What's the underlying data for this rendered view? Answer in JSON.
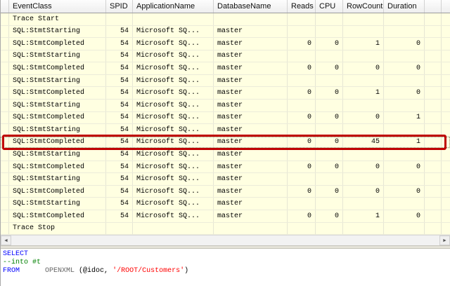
{
  "colors": {
    "row_background": "#ffffe1",
    "highlight_border": "#bf0000",
    "keyword": "#0000ff",
    "comment": "#008000",
    "string": "#ff0000",
    "identifier": "#666666",
    "plain": "#000000"
  },
  "scrollbar": {
    "left_arrow": "◄",
    "right_arrow": "►"
  },
  "grid": {
    "columns": [
      {
        "id": "gutter",
        "label": "",
        "width": 12,
        "align": "left"
      },
      {
        "id": "event",
        "label": "EventClass",
        "width": 138,
        "align": "left"
      },
      {
        "id": "spid",
        "label": "SPID",
        "width": 38,
        "align": "right"
      },
      {
        "id": "app",
        "label": "ApplicationName",
        "width": 115,
        "align": "left"
      },
      {
        "id": "db",
        "label": "DatabaseName",
        "width": 105,
        "align": "left"
      },
      {
        "id": "reads",
        "label": "Reads",
        "width": 40,
        "align": "right"
      },
      {
        "id": "cpu",
        "label": "CPU",
        "width": 39,
        "align": "right"
      },
      {
        "id": "rowcounts",
        "label": "RowCounts",
        "width": 58,
        "align": "right"
      },
      {
        "id": "duration",
        "label": "Duration",
        "width": 58,
        "align": "right"
      },
      {
        "id": "filler",
        "label": "",
        "width": 24,
        "align": "left"
      },
      {
        "id": "filler2",
        "label": "",
        "width": 13,
        "align": "left"
      }
    ],
    "rows": [
      {
        "event": "Trace Start",
        "spid": "",
        "app": "",
        "db": "",
        "reads": "",
        "cpu": "",
        "rowcounts": "",
        "duration": "",
        "highlight": false
      },
      {
        "event": "SQL:StmtStarting",
        "spid": "54",
        "app": "Microsoft SQ...",
        "db": "master",
        "reads": "",
        "cpu": "",
        "rowcounts": "",
        "duration": "",
        "highlight": false
      },
      {
        "event": "SQL:StmtCompleted",
        "spid": "54",
        "app": "Microsoft SQ...",
        "db": "master",
        "reads": "0",
        "cpu": "0",
        "rowcounts": "1",
        "duration": "0",
        "highlight": false
      },
      {
        "event": "SQL:StmtStarting",
        "spid": "54",
        "app": "Microsoft SQ...",
        "db": "master",
        "reads": "",
        "cpu": "",
        "rowcounts": "",
        "duration": "",
        "highlight": false
      },
      {
        "event": "SQL:StmtCompleted",
        "spid": "54",
        "app": "Microsoft SQ...",
        "db": "master",
        "reads": "0",
        "cpu": "0",
        "rowcounts": "0",
        "duration": "0",
        "highlight": false
      },
      {
        "event": "SQL:StmtStarting",
        "spid": "54",
        "app": "Microsoft SQ...",
        "db": "master",
        "reads": "",
        "cpu": "",
        "rowcounts": "",
        "duration": "",
        "highlight": false
      },
      {
        "event": "SQL:StmtCompleted",
        "spid": "54",
        "app": "Microsoft SQ...",
        "db": "master",
        "reads": "0",
        "cpu": "0",
        "rowcounts": "1",
        "duration": "0",
        "highlight": false
      },
      {
        "event": "SQL:StmtStarting",
        "spid": "54",
        "app": "Microsoft SQ...",
        "db": "master",
        "reads": "",
        "cpu": "",
        "rowcounts": "",
        "duration": "",
        "highlight": false
      },
      {
        "event": "SQL:StmtCompleted",
        "spid": "54",
        "app": "Microsoft SQ...",
        "db": "master",
        "reads": "0",
        "cpu": "0",
        "rowcounts": "0",
        "duration": "1",
        "highlight": false
      },
      {
        "event": "SQL:StmtStarting",
        "spid": "54",
        "app": "Microsoft SQ...",
        "db": "master",
        "reads": "",
        "cpu": "",
        "rowcounts": "",
        "duration": "",
        "highlight": false
      },
      {
        "event": "SQL:StmtCompleted",
        "spid": "54",
        "app": "Microsoft SQ...",
        "db": "master",
        "reads": "0",
        "cpu": "0",
        "rowcounts": "45",
        "duration": "1",
        "highlight": true
      },
      {
        "event": "SQL:StmtStarting",
        "spid": "54",
        "app": "Microsoft SQ...",
        "db": "master",
        "reads": "",
        "cpu": "",
        "rowcounts": "",
        "duration": "",
        "highlight": false
      },
      {
        "event": "SQL:StmtCompleted",
        "spid": "54",
        "app": "Microsoft SQ...",
        "db": "master",
        "reads": "0",
        "cpu": "0",
        "rowcounts": "0",
        "duration": "0",
        "highlight": false
      },
      {
        "event": "SQL:StmtStarting",
        "spid": "54",
        "app": "Microsoft SQ...",
        "db": "master",
        "reads": "",
        "cpu": "",
        "rowcounts": "",
        "duration": "",
        "highlight": false
      },
      {
        "event": "SQL:StmtCompleted",
        "spid": "54",
        "app": "Microsoft SQ...",
        "db": "master",
        "reads": "0",
        "cpu": "0",
        "rowcounts": "0",
        "duration": "0",
        "highlight": false
      },
      {
        "event": "SQL:StmtStarting",
        "spid": "54",
        "app": "Microsoft SQ...",
        "db": "master",
        "reads": "",
        "cpu": "",
        "rowcounts": "",
        "duration": "",
        "highlight": false
      },
      {
        "event": "SQL:StmtCompleted",
        "spid": "54",
        "app": "Microsoft SQ...",
        "db": "master",
        "reads": "0",
        "cpu": "0",
        "rowcounts": "1",
        "duration": "0",
        "highlight": false
      },
      {
        "event": "Trace Stop",
        "spid": "",
        "app": "",
        "db": "",
        "reads": "",
        "cpu": "",
        "rowcounts": "",
        "duration": "",
        "highlight": false
      }
    ]
  },
  "sql": {
    "lines": [
      [
        {
          "t": "SELECT",
          "c": "keyword"
        }
      ],
      [
        {
          "t": "--into #t",
          "c": "comment"
        }
      ],
      [
        {
          "t": "FROM",
          "c": "keyword"
        },
        {
          "t": "      ",
          "c": "plain"
        },
        {
          "t": "OPENXML",
          "c": "identifier"
        },
        {
          "t": " (@idoc, ",
          "c": "plain"
        },
        {
          "t": "'/ROOT/Customers'",
          "c": "string"
        },
        {
          "t": ")",
          "c": "plain"
        }
      ]
    ]
  }
}
